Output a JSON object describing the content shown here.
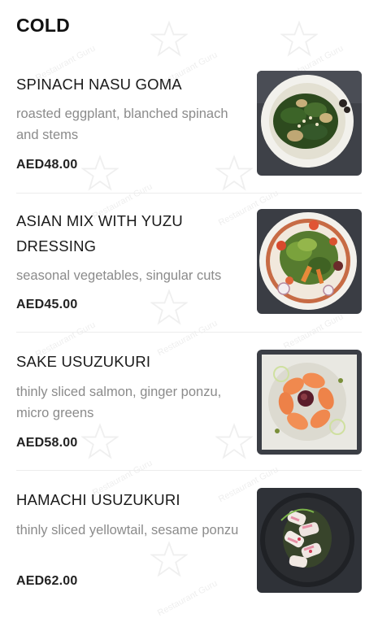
{
  "section": {
    "title": "COLD"
  },
  "watermark": {
    "text": "Restaurant Guru"
  },
  "items": [
    {
      "name": "SPINACH NASU GOMA",
      "description": "roasted eggplant, blanched spinach and stems",
      "price": "AED48.00",
      "photo_icon": "spinach-dish-photo"
    },
    {
      "name": "ASIAN MIX WITH YUZU DRESSING",
      "description": "seasonal vegetables, singular cuts",
      "price": "AED45.00",
      "photo_icon": "salad-dish-photo"
    },
    {
      "name": "SAKE USUZUKURI",
      "description": "thinly sliced salmon, ginger ponzu, micro greens",
      "price": "AED58.00",
      "photo_icon": "salmon-dish-photo"
    },
    {
      "name": "HAMACHI USUZUKURI",
      "description": "thinly sliced yellowtail, sesame ponzu",
      "price": "AED62.00",
      "photo_icon": "yellowtail-dish-photo"
    }
  ]
}
